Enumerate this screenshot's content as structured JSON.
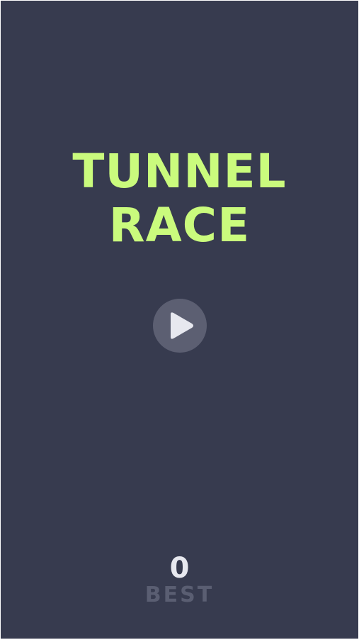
{
  "game": {
    "title_line_1": "TUNNEL",
    "title_line_2": "RACE",
    "best_score": "0",
    "best_label": "BEST"
  },
  "icons": {
    "play": "play-icon"
  },
  "colors": {
    "background": "#373b4f",
    "title": "#cafb7d",
    "play_button": "#5c5f72",
    "play_icon": "#e7e8ef",
    "best_score": "#e7e8ef",
    "best_label": "#5a5e72"
  }
}
